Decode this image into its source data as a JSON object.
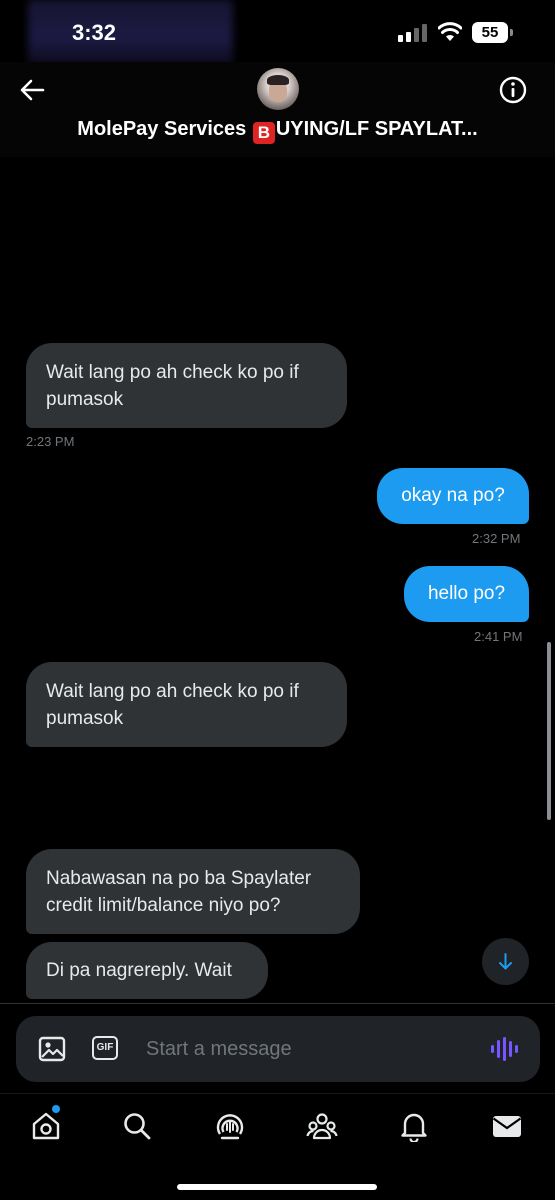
{
  "status_bar": {
    "time": "3:32",
    "battery": "55"
  },
  "header": {
    "title_prefix": "MolePay Services ",
    "title_badge": "B",
    "title_suffix": "UYING/LF SPAYLAT..."
  },
  "messages": [
    {
      "type": "received",
      "text": "Wait lang po ah check ko po if pumasok",
      "time": "2:23 PM"
    },
    {
      "type": "sent",
      "text": "okay na po?",
      "time": "2:32 PM"
    },
    {
      "type": "sent",
      "text": "hello po?",
      "time": "2:41 PM"
    },
    {
      "type": "received",
      "text": "Wait lang po ah check ko po if pumasok"
    },
    {
      "type": "received",
      "text": "Nabawasan na po ba Spaylater credit limit/balance niyo po?"
    },
    {
      "type": "received",
      "text": "Di pa nagrereply. Wait"
    }
  ],
  "composer": {
    "placeholder": "Start a message",
    "gif_label": "GIF"
  },
  "nav": {
    "items": [
      "home-icon",
      "search-icon",
      "spaces-icon",
      "communities-icon",
      "notifications-icon",
      "messages-icon"
    ]
  },
  "colors": {
    "accent": "#1d9bf0",
    "received_bubble": "#2f3336",
    "voice": "#7856ff"
  }
}
